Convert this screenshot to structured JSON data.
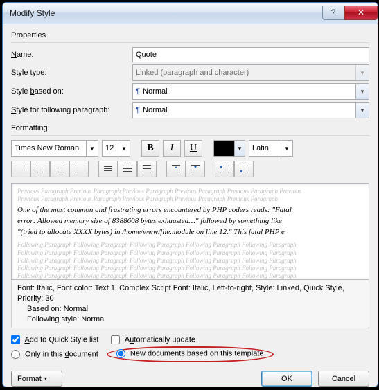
{
  "title": "Modify Style",
  "properties": {
    "group_label": "Properties",
    "name_label": "Name:",
    "name_value": "Quote",
    "style_type_label": "Style type:",
    "style_type_value": "Linked (paragraph and character)",
    "based_on_label": "Style based on:",
    "based_on_value": "Normal",
    "following_label": "Style for following paragraph:",
    "following_value": "Normal"
  },
  "formatting": {
    "group_label": "Formatting",
    "font_name": "Times New Roman",
    "font_size": "12",
    "script": "Latin"
  },
  "preview": {
    "gray_prev": "Previous Paragraph Previous Paragraph Previous Paragraph Previous Paragraph Previous Paragraph Previous",
    "gray_prev2": "Previous Paragraph Previous Paragraph Previous Paragraph Previous Paragraph Previous Paragraph",
    "main1": "One of the most common and frustrating errors encountered by PHP coders reads: \"Fatal",
    "main2": "error: Allowed memory size of 8388608 bytes exhausted…\" followed by something like",
    "main3": "\"(tried to allocate XXXX bytes) in /home/www/file.module on line 12.\" This fatal PHP e",
    "gray_next": "Following Paragraph Following Paragraph Following Paragraph Following Paragraph Following Paragraph"
  },
  "description": {
    "line1": "Font: Italic, Font color: Text 1, Complex Script Font: Italic, Left-to-right, Style: Linked, Quick Style,",
    "line2": "Priority: 30",
    "line3": "Based on: Normal",
    "line4": "Following style: Normal"
  },
  "options": {
    "quick_style": "Add to Quick Style list",
    "auto_update": "Automatically update",
    "only_doc": "Only in this document",
    "new_docs": "New documents based on this template"
  },
  "buttons": {
    "format": "Format",
    "ok": "OK",
    "cancel": "Cancel"
  }
}
